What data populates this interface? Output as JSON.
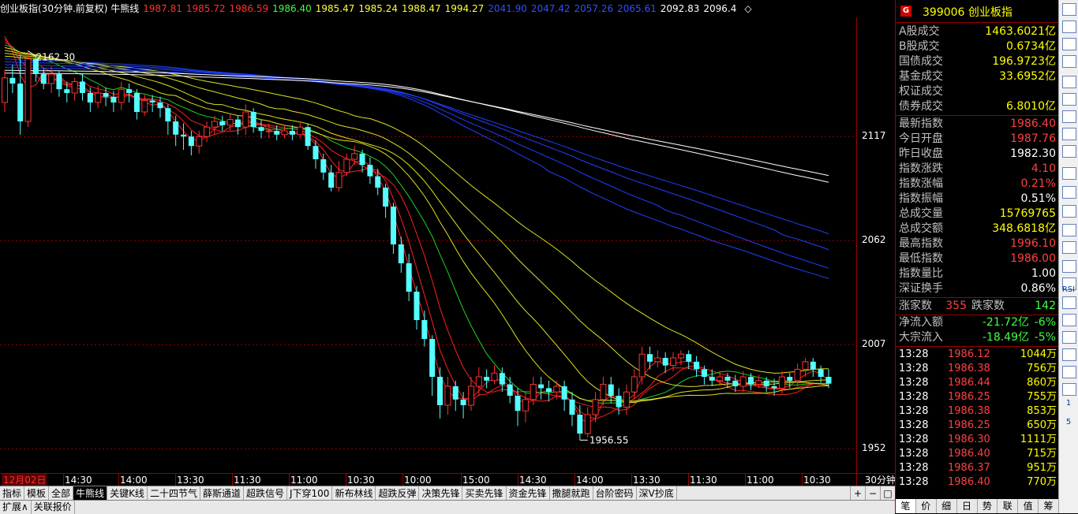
{
  "title_bar": {
    "name": "创业板指(30分钟.前复权) 牛熊线",
    "ma_values": [
      {
        "text": "1987.81",
        "color": "#ff3030"
      },
      {
        "text": "1985.72",
        "color": "#ff3030"
      },
      {
        "text": "1986.59",
        "color": "#ff3030"
      },
      {
        "text": "1986.40",
        "color": "#40ff40"
      },
      {
        "text": "1985.47",
        "color": "#ffff40"
      },
      {
        "text": "1985.24",
        "color": "#ffff40"
      },
      {
        "text": "1988.47",
        "color": "#ffff40"
      },
      {
        "text": "1994.27",
        "color": "#ffff40"
      },
      {
        "text": "2041.90",
        "color": "#3050ff"
      },
      {
        "text": "2047.42",
        "color": "#3050ff"
      },
      {
        "text": "2057.26",
        "color": "#3050ff"
      },
      {
        "text": "2065.61",
        "color": "#3050ff"
      },
      {
        "text": "2092.83",
        "color": "#ffffff"
      },
      {
        "text": "2096.4",
        "color": "#ffffff"
      }
    ],
    "diamond": "◇"
  },
  "price_axis": {
    "labels": [
      "2117",
      "2062",
      "2007",
      "1952"
    ]
  },
  "annotations": {
    "high": "2162.30",
    "low": "1956.55"
  },
  "time_axis": {
    "labels": [
      "12月02日",
      "14:30",
      "14:00",
      "13:30",
      "11:30",
      "11:00",
      "10:30",
      "10:00",
      "15:00",
      "14:30",
      "14:00",
      "13:30",
      "11:30",
      "11:00",
      "10:30"
    ],
    "period": "30分钟"
  },
  "indicator_tabs": {
    "items": [
      "指标",
      "模板",
      "全部",
      "牛熊线",
      "关键K线",
      "二十四节气",
      "薛斯通道",
      "超跌信号",
      "J下穿100",
      "新布林线",
      "超跌反弹",
      "决策先锋",
      "买卖先锋",
      "资金先锋",
      "撒腿就跑",
      "台阶密码",
      "深V抄底"
    ],
    "active": "牛熊线",
    "nav": [
      "+",
      "−",
      "□"
    ]
  },
  "bottom_tabs": {
    "items": [
      "扩展∧",
      "关联报价"
    ]
  },
  "chart_data": {
    "type": "candlestick",
    "title": "创业板指(30分钟.前复权) 牛熊线",
    "ylim": [
      1940,
      2180
    ],
    "y_ticks": [
      2117,
      2062,
      2007,
      1952
    ],
    "x_labels": [
      "12月02日",
      "14:30",
      "14:00",
      "13:30",
      "11:30",
      "11:00",
      "10:30",
      "10:00",
      "15:00",
      "14:30",
      "14:00",
      "13:30",
      "11:30",
      "11:00",
      "10:30"
    ],
    "candles": [
      [
        2135,
        2148,
        2130,
        2152
      ],
      [
        2148,
        2145,
        2140,
        2155
      ],
      [
        2145,
        2125,
        2118,
        2160
      ],
      [
        2125,
        2158,
        2122,
        2162.3
      ],
      [
        2158,
        2150,
        2146,
        2160
      ],
      [
        2150,
        2145,
        2142,
        2153
      ],
      [
        2145,
        2150,
        2140,
        2154
      ],
      [
        2150,
        2142,
        2138,
        2152
      ],
      [
        2142,
        2140,
        2135,
        2146
      ],
      [
        2140,
        2146,
        2136,
        2148
      ],
      [
        2146,
        2140,
        2136,
        2150
      ],
      [
        2140,
        2135,
        2130,
        2143
      ],
      [
        2135,
        2140,
        2132,
        2144
      ],
      [
        2140,
        2138,
        2133,
        2143
      ],
      [
        2138,
        2135,
        2130,
        2141
      ],
      [
        2135,
        2142,
        2131,
        2146
      ],
      [
        2142,
        2140,
        2135,
        2145
      ],
      [
        2140,
        2130,
        2126,
        2142
      ],
      [
        2130,
        2136,
        2128,
        2139
      ],
      [
        2136,
        2135,
        2130,
        2139
      ],
      [
        2135,
        2132,
        2127,
        2138
      ],
      [
        2132,
        2125,
        2118,
        2134
      ],
      [
        2125,
        2118,
        2112,
        2128
      ],
      [
        2118,
        2117,
        2110,
        2124
      ],
      [
        2117,
        2112,
        2107,
        2120
      ],
      [
        2112,
        2117,
        2108,
        2120
      ],
      [
        2117,
        2122,
        2114,
        2125
      ],
      [
        2122,
        2125,
        2118,
        2128
      ],
      [
        2125,
        2123,
        2120,
        2128
      ],
      [
        2123,
        2126,
        2120,
        2129
      ],
      [
        2126,
        2122,
        2118,
        2128
      ],
      [
        2122,
        2130,
        2118,
        2134
      ],
      [
        2130,
        2122,
        2119,
        2132
      ],
      [
        2122,
        2120,
        2116,
        2126
      ],
      [
        2120,
        2120,
        2116,
        2124
      ],
      [
        2120,
        2118,
        2115,
        2123
      ],
      [
        2118,
        2120,
        2116,
        2123
      ],
      [
        2120,
        2118,
        2115,
        2123
      ],
      [
        2118,
        2122,
        2116,
        2125
      ],
      [
        2122,
        2112,
        2110,
        2124
      ],
      [
        2112,
        2105,
        2100,
        2115
      ],
      [
        2105,
        2098,
        2094,
        2108
      ],
      [
        2098,
        2090,
        2088,
        2102
      ],
      [
        2090,
        2098,
        2088,
        2104
      ],
      [
        2098,
        2105,
        2096,
        2108
      ],
      [
        2105,
        2108,
        2102,
        2112
      ],
      [
        2108,
        2102,
        2098,
        2110
      ],
      [
        2102,
        2096,
        2092,
        2106
      ],
      [
        2096,
        2090,
        2086,
        2100
      ],
      [
        2090,
        2080,
        2074,
        2092
      ],
      [
        2080,
        2060,
        2055,
        2082
      ],
      [
        2060,
        2050,
        2045,
        2064
      ],
      [
        2050,
        2035,
        2030,
        2055
      ],
      [
        2035,
        2020,
        2015,
        2038
      ],
      [
        2020,
        2010,
        2006,
        2025
      ],
      [
        2010,
        1990,
        1980,
        2012
      ],
      [
        1990,
        1975,
        1968,
        1995
      ],
      [
        1975,
        1985,
        1970,
        1990
      ],
      [
        1985,
        1978,
        1972,
        1988
      ],
      [
        1978,
        1975,
        1968,
        1982
      ],
      [
        1975,
        1985,
        1972,
        1990
      ],
      [
        1985,
        1990,
        1980,
        1995
      ],
      [
        1990,
        1988,
        1984,
        1994
      ],
      [
        1988,
        1992,
        1986,
        1996
      ],
      [
        1992,
        1986,
        1982,
        1995
      ],
      [
        1986,
        1980,
        1976,
        1990
      ],
      [
        1980,
        1972,
        1964,
        1984
      ],
      [
        1972,
        1978,
        1966,
        1982
      ],
      [
        1978,
        1986,
        1975,
        1990
      ],
      [
        1986,
        1984,
        1978,
        1990
      ],
      [
        1984,
        1982,
        1977,
        1988
      ],
      [
        1982,
        1985,
        1978,
        1988
      ],
      [
        1985,
        1978,
        1972,
        1988
      ],
      [
        1978,
        1970,
        1964,
        1982
      ],
      [
        1970,
        1960,
        1956.55,
        1975
      ],
      [
        1960,
        1970,
        1958,
        1974
      ],
      [
        1970,
        1978,
        1966,
        1982
      ],
      [
        1978,
        1986,
        1975,
        1990
      ],
      [
        1986,
        1980,
        1976,
        1990
      ],
      [
        1980,
        1974,
        1970,
        1984
      ],
      [
        1974,
        1982,
        1970,
        1986
      ],
      [
        1982,
        1990,
        1978,
        1994
      ],
      [
        1990,
        2002,
        1986,
        2006
      ],
      [
        2002,
        1998,
        1994,
        2006
      ],
      [
        1998,
        2000,
        1995,
        2004
      ],
      [
        2000,
        1996,
        1992,
        2003
      ],
      [
        1996,
        2000,
        1993,
        2003
      ],
      [
        2000,
        2002,
        1996,
        2004
      ],
      [
        2002,
        1998,
        1994,
        2004
      ],
      [
        1998,
        1994,
        1990,
        2001
      ],
      [
        1994,
        1990,
        1986,
        1996
      ],
      [
        1990,
        1988,
        1985,
        1994
      ],
      [
        1988,
        1990,
        1985,
        1993
      ],
      [
        1990,
        1988,
        1984,
        1992
      ],
      [
        1988,
        1985,
        1982,
        1991
      ],
      [
        1985,
        1990,
        1982,
        1993
      ],
      [
        1990,
        1986,
        1983,
        1992
      ],
      [
        1986,
        1988,
        1984,
        1991
      ],
      [
        1988,
        1985,
        1982,
        1990
      ],
      [
        1985,
        1984,
        1980,
        1989
      ],
      [
        1984,
        1990,
        1981,
        1993
      ],
      [
        1990,
        1988,
        1984,
        1992
      ],
      [
        1988,
        1994,
        1985,
        1997
      ],
      [
        1994,
        1998,
        1990,
        2000
      ],
      [
        1998,
        1994,
        1990,
        2000
      ],
      [
        1994,
        1990,
        1987,
        1996
      ],
      [
        1990,
        1986.4,
        1984,
        1994
      ]
    ],
    "series": [
      {
        "color": "#ff2020",
        "end": 1987.81
      },
      {
        "color": "#ff2020",
        "end": 1985.72
      },
      {
        "color": "#ff2020",
        "end": 1986.59
      },
      {
        "color": "#20d020",
        "end": 1986.4
      },
      {
        "color": "#e0e020",
        "end": 1985.47
      },
      {
        "color": "#e0e020",
        "end": 1985.24
      },
      {
        "color": "#e0e020",
        "end": 1988.47
      },
      {
        "color": "#e0e020",
        "end": 1994.27
      },
      {
        "color": "#2040ff",
        "end": 2041.9
      },
      {
        "color": "#2040ff",
        "end": 2047.42
      },
      {
        "color": "#2040ff",
        "end": 2057.26
      },
      {
        "color": "#2040ff",
        "end": 2065.61
      },
      {
        "color": "#ffffff",
        "end": 2092.83
      },
      {
        "color": "#ffffff",
        "end": 2096.4
      }
    ]
  },
  "panel": {
    "code": "399006 创业板指",
    "badge": "G",
    "volume_rows": [
      {
        "label": "A股成交",
        "value": "1463.6021亿",
        "color": "#ffff00"
      },
      {
        "label": "B股成交",
        "value": "0.6734亿",
        "color": "#ffff00"
      },
      {
        "label": "国债成交",
        "value": "196.9723亿",
        "color": "#ffff00"
      },
      {
        "label": "基金成交",
        "value": "33.6952亿",
        "color": "#ffff00"
      },
      {
        "label": "权证成交",
        "value": "",
        "color": "#ffff00"
      },
      {
        "label": "债券成交",
        "value": "6.8010亿",
        "color": "#ffff00"
      }
    ],
    "index_rows": [
      {
        "label": "最新指数",
        "value": "1986.40",
        "color": "#ff4040"
      },
      {
        "label": "今日开盘",
        "value": "1987.76",
        "color": "#ff4040"
      },
      {
        "label": "昨日收盘",
        "value": "1982.30",
        "color": "#ffffff"
      },
      {
        "label": "指数涨跌",
        "value": "4.10",
        "color": "#ff4040"
      },
      {
        "label": "指数涨幅",
        "value": "0.21%",
        "color": "#ff4040"
      },
      {
        "label": "指数振幅",
        "value": "0.51%",
        "color": "#ffffff"
      },
      {
        "label": "总成交量",
        "value": "15769765",
        "color": "#ffff00"
      },
      {
        "label": "总成交额",
        "value": "348.6818亿",
        "color": "#ffff00"
      },
      {
        "label": "最高指数",
        "value": "1996.10",
        "color": "#ff4040"
      },
      {
        "label": "最低指数",
        "value": "1986.00",
        "color": "#ff4040"
      },
      {
        "label": "指数量比",
        "value": "1.00",
        "color": "#ffffff"
      },
      {
        "label": "深证换手",
        "value": "0.86%",
        "color": "#ffffff"
      }
    ],
    "updown": {
      "up_label": "涨家数",
      "up": "355",
      "down_label": "跌家数",
      "down": "142"
    },
    "flow_rows": [
      {
        "label": "净流入额",
        "value": "-21.72亿",
        "pct": "-6%"
      },
      {
        "label": "大宗流入",
        "value": "-18.49亿",
        "pct": "-5%"
      }
    ],
    "trades": [
      {
        "time": "13:28",
        "price": "1986.12",
        "vol": "1044万"
      },
      {
        "time": "13:28",
        "price": "1986.38",
        "vol": "756万"
      },
      {
        "time": "13:28",
        "price": "1986.44",
        "vol": "860万"
      },
      {
        "time": "13:28",
        "price": "1986.25",
        "vol": "755万"
      },
      {
        "time": "13:28",
        "price": "1986.38",
        "vol": "853万"
      },
      {
        "time": "13:28",
        "price": "1986.25",
        "vol": "650万"
      },
      {
        "time": "13:28",
        "price": "1986.30",
        "vol": "1111万"
      },
      {
        "time": "13:28",
        "price": "1986.40",
        "vol": "715万"
      },
      {
        "time": "13:28",
        "price": "1986.37",
        "vol": "951万"
      },
      {
        "time": "13:28",
        "price": "1986.40",
        "vol": "770万"
      }
    ],
    "bottom_tabs": [
      "笔",
      "价",
      "细",
      "日",
      "势",
      "联",
      "值",
      "筹"
    ]
  },
  "side_toolbar": {
    "texts": [
      "1",
      "5",
      "RSI"
    ]
  }
}
